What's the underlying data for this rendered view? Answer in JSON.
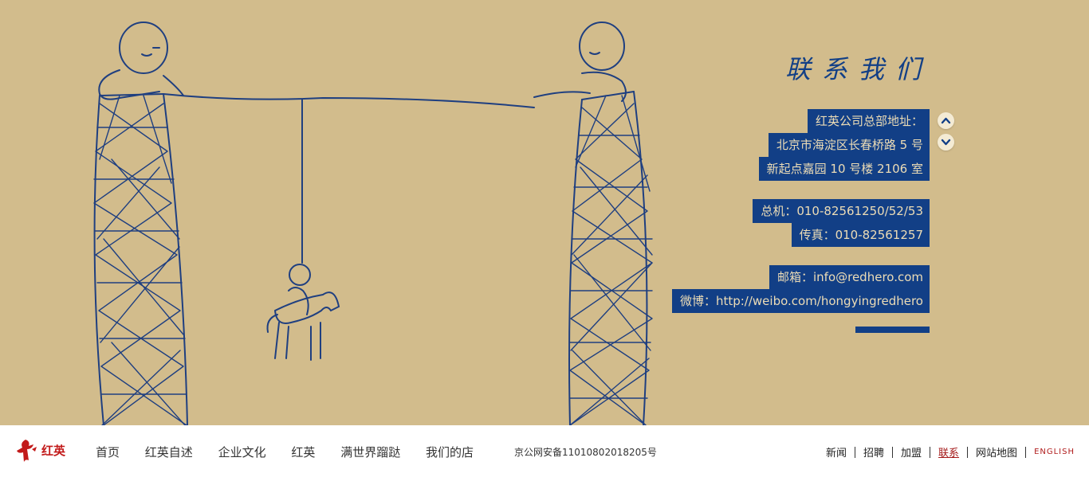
{
  "contact": {
    "title": "联系我们",
    "hq_label": "红英公司总部地址：",
    "address_line1": "北京市海淀区长春桥路 5 号",
    "address_line2": "新起点嘉园 10 号楼 2106 室",
    "phone": "总机：010-82561250/52/53",
    "fax": "传真：010-82561257",
    "email": "邮箱：info@redhero.com",
    "weibo": "微博：http://weibo.com/hongyingredhero"
  },
  "colors": {
    "background": "#d2bc8c",
    "accent_blue": "#123f86",
    "label_text": "#ecdcb6",
    "brand_red": "#c21a1a"
  },
  "icons": {
    "scroll_up": "chevron-up-icon",
    "scroll_down": "chevron-down-icon"
  },
  "footer": {
    "logo_text": "红英",
    "nav": [
      "首页",
      "红英自述",
      "企业文化",
      "红英",
      "满世界蹓跶",
      "我们的店"
    ],
    "icp": "京公网安备11010802018205号",
    "links": [
      "新闻",
      "招聘",
      "加盟",
      "联系",
      "网站地图"
    ],
    "english": "ENGLISH",
    "active_link": "联系"
  }
}
